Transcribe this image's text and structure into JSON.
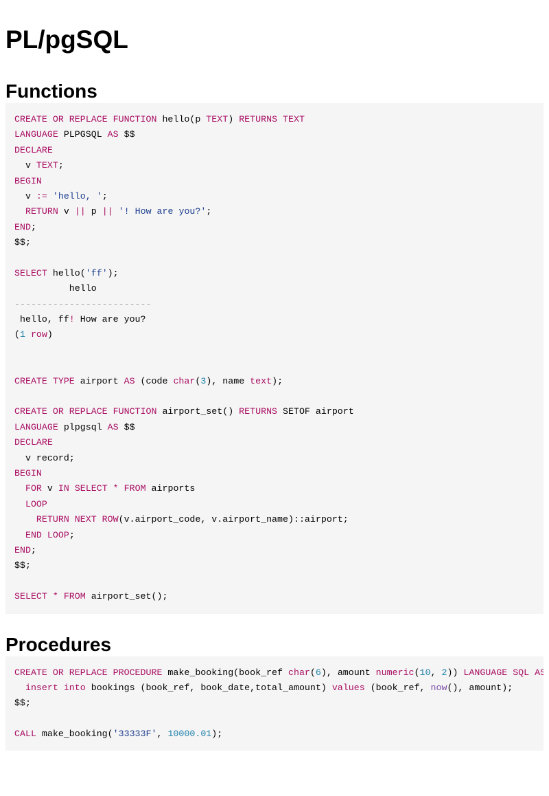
{
  "title": "PL/pgSQL",
  "sections": [
    {
      "heading": "Functions",
      "code": [
        [
          [
            "kw",
            "CREATE OR REPLACE FUNCTION"
          ],
          [
            "pl",
            " hello(p "
          ],
          [
            "kw",
            "TEXT"
          ],
          [
            "pl",
            ") "
          ],
          [
            "kw",
            "RETURNS TEXT"
          ]
        ],
        [
          [
            "kw",
            "LANGUAGE"
          ],
          [
            "pl",
            " PLPGSQL "
          ],
          [
            "kw",
            "AS"
          ],
          [
            "pl",
            " $$"
          ]
        ],
        [
          [
            "kw",
            "DECLARE"
          ]
        ],
        [
          [
            "pl",
            "  v "
          ],
          [
            "kw",
            "TEXT"
          ],
          [
            "pl",
            ";"
          ]
        ],
        [
          [
            "kw",
            "BEGIN"
          ]
        ],
        [
          [
            "pl",
            "  v "
          ],
          [
            "kw",
            ":="
          ],
          [
            "pl",
            " "
          ],
          [
            "str",
            "'hello, '"
          ],
          [
            "pl",
            ";"
          ]
        ],
        [
          [
            "pl",
            "  "
          ],
          [
            "kw",
            "RETURN"
          ],
          [
            "pl",
            " v "
          ],
          [
            "kw",
            "||"
          ],
          [
            "pl",
            " p "
          ],
          [
            "kw",
            "||"
          ],
          [
            "pl",
            " "
          ],
          [
            "str",
            "'! How are you?'"
          ],
          [
            "pl",
            ";"
          ]
        ],
        [
          [
            "kw",
            "END"
          ],
          [
            "pl",
            ";"
          ]
        ],
        [
          [
            "pl",
            "$$;"
          ]
        ],
        [],
        [
          [
            "kw",
            "SELECT"
          ],
          [
            "pl",
            " hello("
          ],
          [
            "str",
            "'ff'"
          ],
          [
            "pl",
            ");"
          ]
        ],
        [
          [
            "pl",
            "          hello"
          ]
        ],
        [
          [
            "cm",
            "-------------------------"
          ]
        ],
        [
          [
            "pl",
            " hello, ff"
          ],
          [
            "kw",
            "!"
          ],
          [
            "pl",
            " How are you?"
          ]
        ],
        [
          [
            "pl",
            "("
          ],
          [
            "num",
            "1"
          ],
          [
            "pl",
            " "
          ],
          [
            "kw",
            "row"
          ],
          [
            "pl",
            ")"
          ]
        ],
        [],
        [],
        [
          [
            "kw",
            "CREATE TYPE"
          ],
          [
            "pl",
            " airport "
          ],
          [
            "kw",
            "AS"
          ],
          [
            "pl",
            " (code "
          ],
          [
            "kw",
            "char"
          ],
          [
            "pl",
            "("
          ],
          [
            "num",
            "3"
          ],
          [
            "pl",
            "), name "
          ],
          [
            "kw",
            "text"
          ],
          [
            "pl",
            ");"
          ]
        ],
        [],
        [
          [
            "kw",
            "CREATE OR REPLACE FUNCTION"
          ],
          [
            "pl",
            " airport_set() "
          ],
          [
            "kw",
            "RETURNS"
          ],
          [
            "pl",
            " SETOF airport"
          ]
        ],
        [
          [
            "kw",
            "LANGUAGE"
          ],
          [
            "pl",
            " plpgsql "
          ],
          [
            "kw",
            "AS"
          ],
          [
            "pl",
            " $$"
          ]
        ],
        [
          [
            "kw",
            "DECLARE"
          ]
        ],
        [
          [
            "pl",
            "  v record;"
          ]
        ],
        [
          [
            "kw",
            "BEGIN"
          ]
        ],
        [
          [
            "pl",
            "  "
          ],
          [
            "kw",
            "FOR"
          ],
          [
            "pl",
            " v "
          ],
          [
            "kw",
            "IN SELECT * FROM"
          ],
          [
            "pl",
            " airports"
          ]
        ],
        [
          [
            "pl",
            "  "
          ],
          [
            "kw",
            "LOOP"
          ]
        ],
        [
          [
            "pl",
            "    "
          ],
          [
            "kw",
            "RETURN NEXT ROW"
          ],
          [
            "pl",
            "(v.airport_code, v.airport_name)::airport;"
          ]
        ],
        [
          [
            "pl",
            "  "
          ],
          [
            "kw",
            "END LOOP"
          ],
          [
            "pl",
            ";"
          ]
        ],
        [
          [
            "kw",
            "END"
          ],
          [
            "pl",
            ";"
          ]
        ],
        [
          [
            "pl",
            "$$;"
          ]
        ],
        [],
        [
          [
            "kw",
            "SELECT * FROM"
          ],
          [
            "pl",
            " airport_set();"
          ]
        ]
      ]
    },
    {
      "heading": "Procedures",
      "code": [
        [
          [
            "kw",
            "CREATE OR REPLACE PROCEDURE"
          ],
          [
            "pl",
            " make_booking(book_ref "
          ],
          [
            "kw",
            "char"
          ],
          [
            "pl",
            "("
          ],
          [
            "num",
            "6"
          ],
          [
            "pl",
            "), amount "
          ],
          [
            "kw",
            "numeric"
          ],
          [
            "pl",
            "("
          ],
          [
            "num",
            "10"
          ],
          [
            "pl",
            ", "
          ],
          [
            "num",
            "2"
          ],
          [
            "pl",
            ")) "
          ],
          [
            "kw",
            "LANGUAGE SQL AS"
          ],
          [
            "pl",
            " $$"
          ]
        ],
        [
          [
            "pl",
            "  "
          ],
          [
            "kw",
            "insert into"
          ],
          [
            "pl",
            " bookings (book_ref, book_date,total_amount) "
          ],
          [
            "kw",
            "values"
          ],
          [
            "pl",
            " (book_ref, "
          ],
          [
            "fn",
            "now"
          ],
          [
            "pl",
            "(), amount);"
          ]
        ],
        [
          [
            "pl",
            "$$;"
          ]
        ],
        [],
        [
          [
            "kw",
            "CALL"
          ],
          [
            "pl",
            " make_booking("
          ],
          [
            "str",
            "'33333F'"
          ],
          [
            "pl",
            ", "
          ],
          [
            "num",
            "10000.01"
          ],
          [
            "pl",
            ");"
          ]
        ]
      ]
    }
  ]
}
